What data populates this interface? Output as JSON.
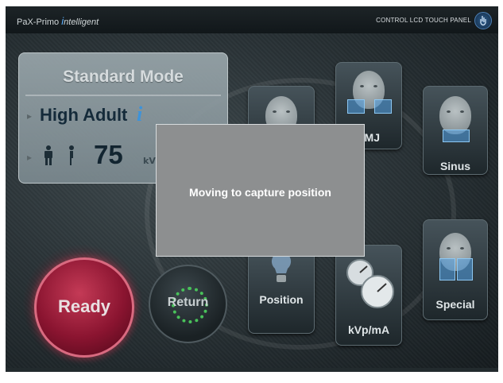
{
  "header": {
    "brand_prefix": "PaX-Primo",
    "brand_i": "i",
    "brand_suffix": "ntelligent",
    "panel_label": "CONTROL LCD TOUCH PANEL"
  },
  "mode_panel": {
    "title": "Standard Mode",
    "subtitle": "High Adult",
    "subtitle_i": "i",
    "kvp_value": "75",
    "kvp_unit": "kVp"
  },
  "tiles": {
    "tmj": "TMJ",
    "sinus": "Sinus",
    "position": "Position",
    "special": "Special",
    "kvp_ma": "kVp/mA"
  },
  "dialog": {
    "message": "Moving to capture position"
  },
  "buttons": {
    "ready": "Ready",
    "return": "Return"
  },
  "colors": {
    "ready_red": "#8a1430",
    "return_green": "#49c25a",
    "accent_blue": "#3e9ae6"
  },
  "icons": [
    "hand-touch-icon",
    "male-figure-icon",
    "female-figure-icon",
    "face-icon",
    "gauge-icon",
    "bulb-icon"
  ]
}
